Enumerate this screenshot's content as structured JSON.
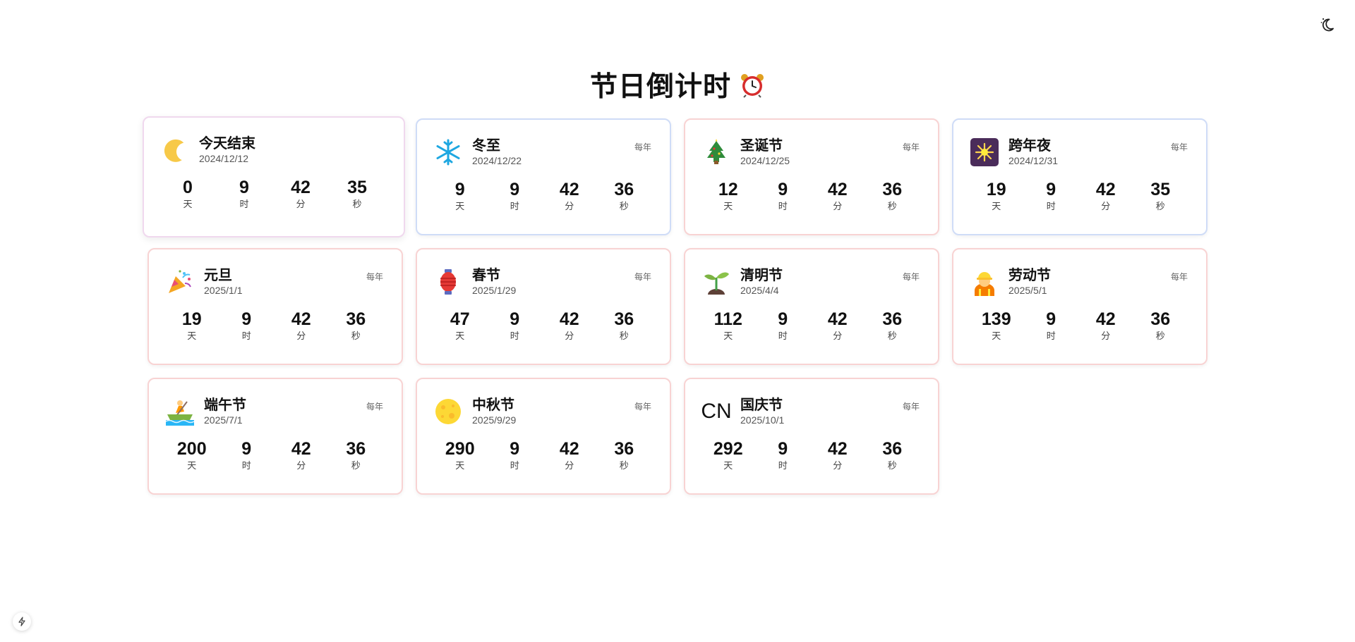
{
  "header": {
    "title": "节日倒计时",
    "title_icon": "alarm-clock-icon",
    "theme_toggle_icon": "moon-stars-icon"
  },
  "cards": [
    {
      "icon": "crescent-moon-icon",
      "name": "今天结束",
      "date": "2024/12/12",
      "repeat": "",
      "days": "0",
      "hours": "9",
      "minutes": "42",
      "seconds": "35",
      "unit_days": "天",
      "unit_hours": "时",
      "unit_minutes": "分",
      "unit_seconds": "秒",
      "border": "#f0d8ee"
    },
    {
      "icon": "snowflake-icon",
      "name": "冬至",
      "date": "2024/12/22",
      "repeat": "每年",
      "days": "9",
      "hours": "9",
      "minutes": "42",
      "seconds": "36",
      "unit_days": "天",
      "unit_hours": "时",
      "unit_minutes": "分",
      "unit_seconds": "秒",
      "border": "#cfdcf7"
    },
    {
      "icon": "christmas-tree-icon",
      "name": "圣诞节",
      "date": "2024/12/25",
      "repeat": "每年",
      "days": "12",
      "hours": "9",
      "minutes": "42",
      "seconds": "36",
      "unit_days": "天",
      "unit_hours": "时",
      "unit_minutes": "分",
      "unit_seconds": "秒",
      "border": "#f8d3d3"
    },
    {
      "icon": "fireworks-icon",
      "name": "跨年夜",
      "date": "2024/12/31",
      "repeat": "每年",
      "days": "19",
      "hours": "9",
      "minutes": "42",
      "seconds": "35",
      "unit_days": "天",
      "unit_hours": "时",
      "unit_minutes": "分",
      "unit_seconds": "秒",
      "border": "#cfdcf7"
    },
    {
      "icon": "party-popper-icon",
      "name": "元旦",
      "date": "2025/1/1",
      "repeat": "每年",
      "days": "19",
      "hours": "9",
      "minutes": "42",
      "seconds": "36",
      "unit_days": "天",
      "unit_hours": "时",
      "unit_minutes": "分",
      "unit_seconds": "秒",
      "border": "#f8d3d3"
    },
    {
      "icon": "red-lantern-icon",
      "name": "春节",
      "date": "2025/1/29",
      "repeat": "每年",
      "days": "47",
      "hours": "9",
      "minutes": "42",
      "seconds": "36",
      "unit_days": "天",
      "unit_hours": "时",
      "unit_minutes": "分",
      "unit_seconds": "秒",
      "border": "#f8d3d3"
    },
    {
      "icon": "seedling-icon",
      "name": "清明节",
      "date": "2025/4/4",
      "repeat": "每年",
      "days": "112",
      "hours": "9",
      "minutes": "42",
      "seconds": "36",
      "unit_days": "天",
      "unit_hours": "时",
      "unit_minutes": "分",
      "unit_seconds": "秒",
      "border": "#f8d3d3"
    },
    {
      "icon": "construction-worker-icon",
      "name": "劳动节",
      "date": "2025/5/1",
      "repeat": "每年",
      "days": "139",
      "hours": "9",
      "minutes": "42",
      "seconds": "36",
      "unit_days": "天",
      "unit_hours": "时",
      "unit_minutes": "分",
      "unit_seconds": "秒",
      "border": "#f8d3d3"
    },
    {
      "icon": "rowing-boat-icon",
      "name": "端午节",
      "date": "2025/7/1",
      "repeat": "每年",
      "days": "200",
      "hours": "9",
      "minutes": "42",
      "seconds": "36",
      "unit_days": "天",
      "unit_hours": "时",
      "unit_minutes": "分",
      "unit_seconds": "秒",
      "border": "#f8d3d3"
    },
    {
      "icon": "full-moon-icon",
      "name": "中秋节",
      "date": "2025/9/29",
      "repeat": "每年",
      "days": "290",
      "hours": "9",
      "minutes": "42",
      "seconds": "36",
      "unit_days": "天",
      "unit_hours": "时",
      "unit_minutes": "分",
      "unit_seconds": "秒",
      "border": "#f8d3d3"
    },
    {
      "icon": "china-flag-icon",
      "icon_text": "CN",
      "name": "国庆节",
      "date": "2025/10/1",
      "repeat": "每年",
      "days": "292",
      "hours": "9",
      "minutes": "42",
      "seconds": "36",
      "unit_days": "天",
      "unit_hours": "时",
      "unit_minutes": "分",
      "unit_seconds": "秒",
      "border": "#f8d3d3"
    }
  ],
  "footer": {
    "badge_icon": "lightning-bolt-icon"
  }
}
